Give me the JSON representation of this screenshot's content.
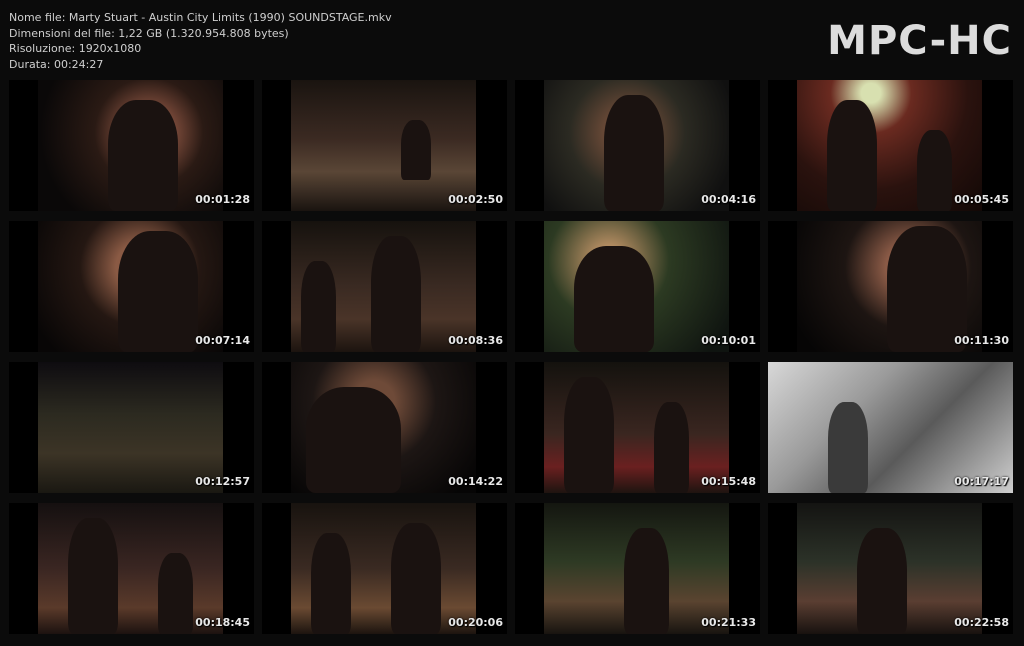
{
  "info": {
    "filename": "Nome file: Marty Stuart - Austin City Limits (1990) SOUNDSTAGE.mkv",
    "filesize": "Dimensioni del file: 1,22 GB (1.320.954.808 bytes)",
    "resolution": "Risoluzione: 1920x1080",
    "duration": "Durata: 00:24:27"
  },
  "logo": "MPC-HC",
  "thumbnails": [
    {
      "time": "00:01:28",
      "scene": "s1"
    },
    {
      "time": "00:02:50",
      "scene": "s2"
    },
    {
      "time": "00:04:16",
      "scene": "s3"
    },
    {
      "time": "00:05:45",
      "scene": "s4"
    },
    {
      "time": "00:07:14",
      "scene": "s5"
    },
    {
      "time": "00:08:36",
      "scene": "s6"
    },
    {
      "time": "00:10:01",
      "scene": "s7"
    },
    {
      "time": "00:11:30",
      "scene": "s8"
    },
    {
      "time": "00:12:57",
      "scene": "s9"
    },
    {
      "time": "00:14:22",
      "scene": "s10"
    },
    {
      "time": "00:15:48",
      "scene": "s11"
    },
    {
      "time": "00:17:17",
      "scene": "s12"
    },
    {
      "time": "00:18:45",
      "scene": "s13"
    },
    {
      "time": "00:20:06",
      "scene": "s14"
    },
    {
      "time": "00:21:33",
      "scene": "s15"
    },
    {
      "time": "00:22:58",
      "scene": "s16"
    }
  ]
}
